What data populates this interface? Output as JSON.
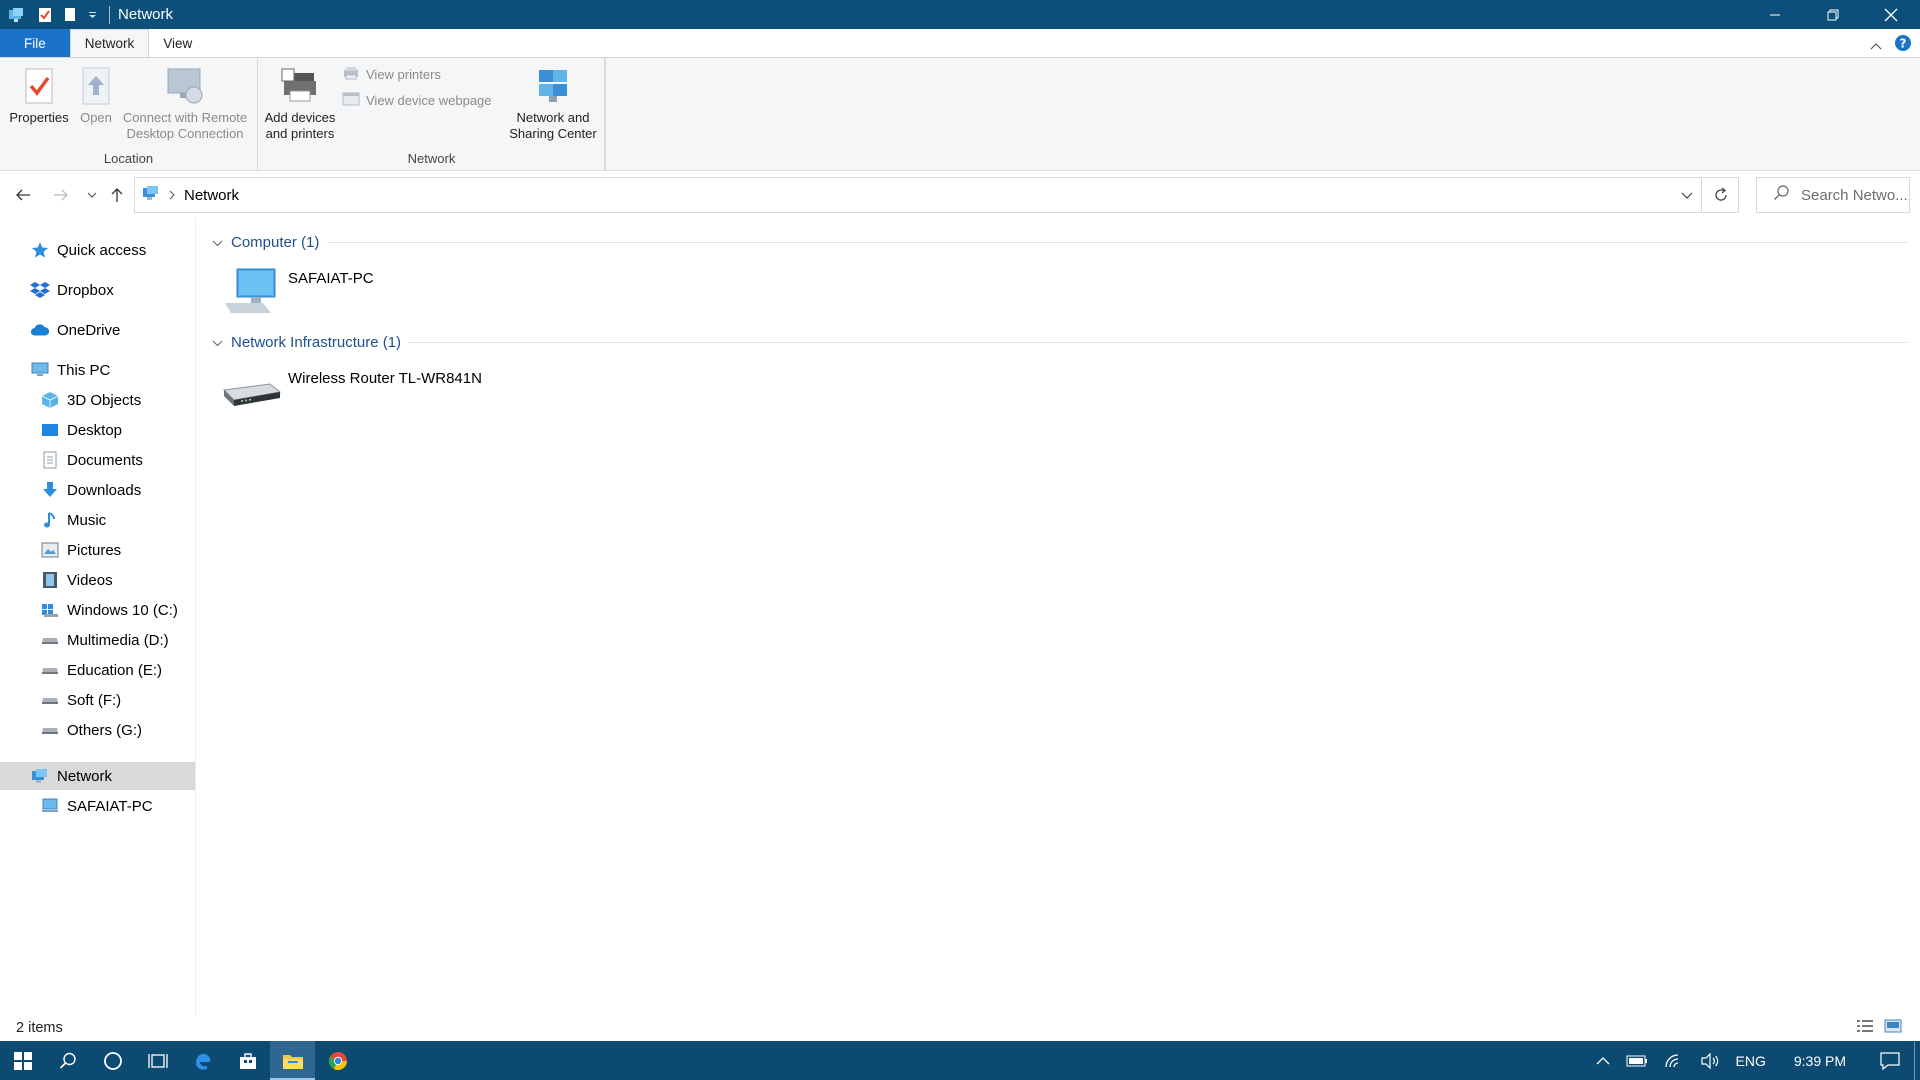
{
  "window": {
    "title": "Network"
  },
  "ribbon": {
    "tabs": {
      "file": "File",
      "network": "Network",
      "view": "View"
    },
    "location_group": {
      "label": "Location",
      "properties": "Properties",
      "open": "Open",
      "connect_line1": "Connect with Remote",
      "connect_line2": "Desktop Connection"
    },
    "network_group": {
      "label": "Network",
      "add_devices_line1": "Add devices",
      "add_devices_line2": "and printers",
      "view_printers": "View printers",
      "view_device_webpage": "View device webpage",
      "sharing_line1": "Network and",
      "sharing_line2": "Sharing Center"
    }
  },
  "address": {
    "crumb": "Network",
    "search_placeholder": "Search Netwo..."
  },
  "sidebar": {
    "quick_access": "Quick access",
    "dropbox": "Dropbox",
    "onedrive": "OneDrive",
    "this_pc": "This PC",
    "objects3d": "3D Objects",
    "desktop": "Desktop",
    "documents": "Documents",
    "downloads": "Downloads",
    "music": "Music",
    "pictures": "Pictures",
    "videos": "Videos",
    "drive_c": "Windows 10 (C:)",
    "drive_d": "Multimedia (D:)",
    "drive_e": "Education (E:)",
    "drive_f": "Soft (F:)",
    "drive_g": "Others (G:)",
    "network": "Network",
    "safaiat_pc": "SAFAIAT-PC"
  },
  "content": {
    "computer_group": "Computer (1)",
    "computer_item": "SAFAIAT-PC",
    "infra_group": "Network Infrastructure (1)",
    "infra_item": "Wireless Router TL-WR841N"
  },
  "status": {
    "count": "2 items"
  },
  "taskbar": {
    "language": "ENG",
    "time": "9:39 PM"
  },
  "colors": {
    "titlebar": "#0b4f7a",
    "file_tab": "#1a73c8",
    "taskbar": "#0d4a72",
    "group_header": "#1e4e8c"
  }
}
